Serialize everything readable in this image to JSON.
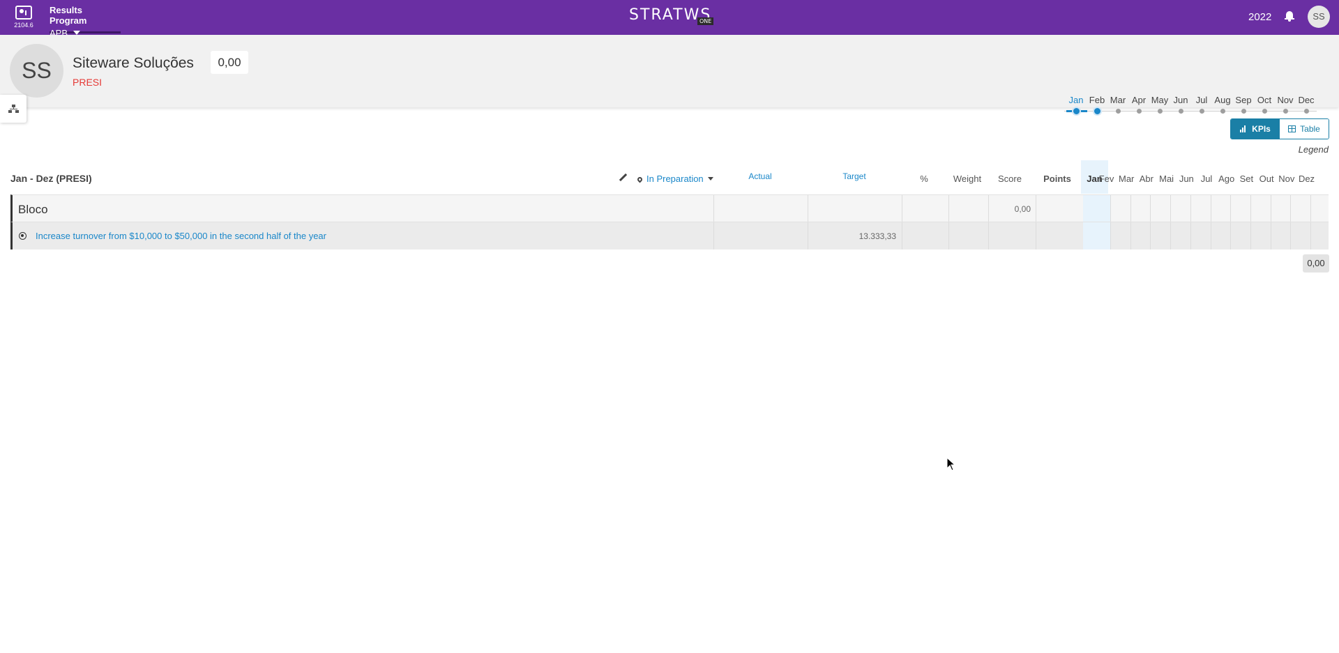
{
  "topbar": {
    "version": "2104.6",
    "program_title": "Results Program",
    "program_selected": "APB",
    "logo_text": "STRATWS",
    "logo_badge": "ONE",
    "year": "2022",
    "user_initials": "SS",
    "color": "#6a2fa3"
  },
  "header": {
    "avatar_initials": "SS",
    "org_name": "Siteware Soluções",
    "org_code": "PRESI",
    "score": "0,00",
    "months": [
      "Jan",
      "Feb",
      "Mar",
      "Apr",
      "May",
      "Jun",
      "Jul",
      "Aug",
      "Sep",
      "Oct",
      "Nov",
      "Dec"
    ],
    "selected_month": "Jan"
  },
  "view_toggle": {
    "kpis_label": "KPIs",
    "table_label": "Table",
    "active": "KPIs",
    "legend_label": "Legend"
  },
  "table": {
    "period_label": "Jan - Dez (PRESI)",
    "status_label": "In Preparation",
    "columns": {
      "actual": "Actual",
      "target": "Target",
      "percent": "%",
      "weight": "Weight",
      "score": "Score",
      "points": "Points"
    },
    "month_columns": [
      "Jan",
      "Fev",
      "Mar",
      "Abr",
      "Mai",
      "Jun",
      "Jul",
      "Ago",
      "Set",
      "Out",
      "Nov",
      "Dez"
    ],
    "block": {
      "name": "Bloco",
      "score": "0,00"
    },
    "kpi": {
      "name": "Increase turnover from $10,000 to $50,000 in the second half of the year",
      "target": "13.333,33"
    },
    "total": "0,00"
  }
}
